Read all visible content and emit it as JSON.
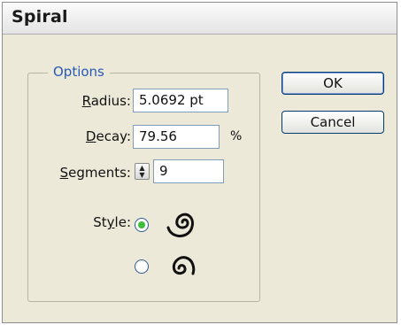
{
  "window": {
    "title": "Spiral"
  },
  "options": {
    "legend": "Options",
    "radius": {
      "label_key": "R",
      "label_rest": "adius:",
      "value": "5.0692 pt"
    },
    "decay": {
      "label_key": "D",
      "label_rest": "ecay:",
      "value": "79.56",
      "unit": "%"
    },
    "segments": {
      "label_key": "S",
      "label_rest": "egments:",
      "value": "9"
    },
    "style": {
      "label_pre": "St",
      "label_key": "y",
      "label_rest": "le:",
      "selected": "counterclockwise"
    }
  },
  "buttons": {
    "ok": "OK",
    "cancel": "Cancel"
  },
  "colors": {
    "radio_selected": "#3fbe3c",
    "legend_text": "#2559b8"
  },
  "icons": [
    "spiral-counterclockwise-icon",
    "spiral-clockwise-icon",
    "stepper-up-down-icon"
  ]
}
